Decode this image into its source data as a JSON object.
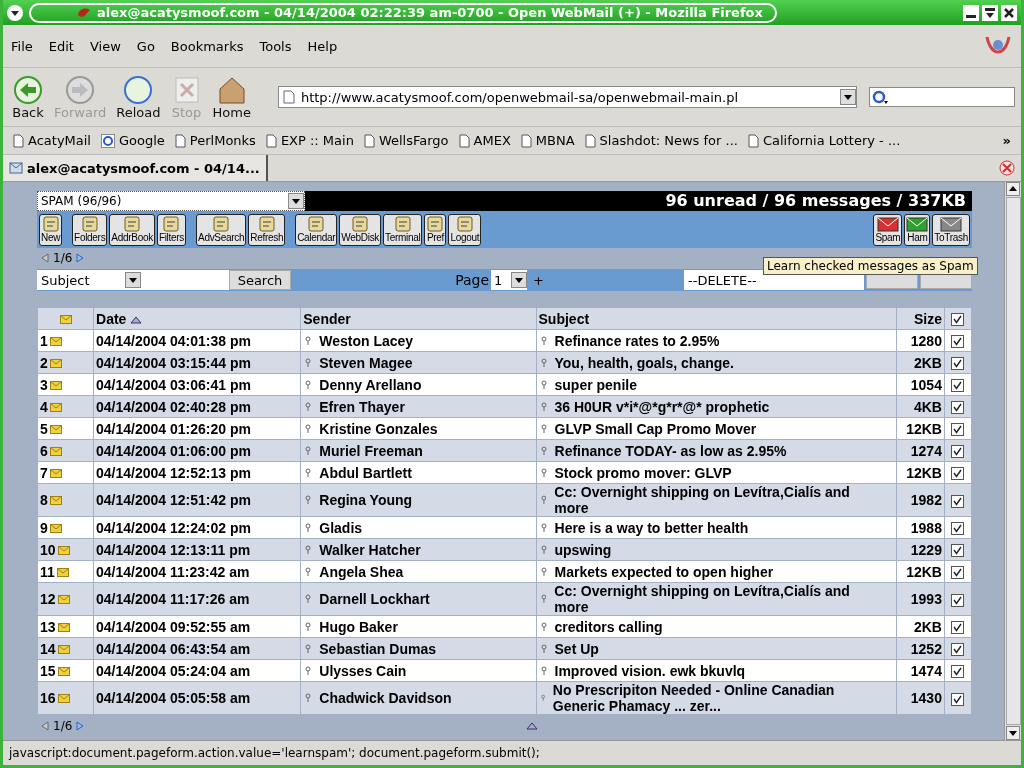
{
  "window": {
    "title": "alex@acatysmoof.com - 04/14/2004 02:22:39 am-0700 - Open WebMail (+) - Mozilla Firefox"
  },
  "menu": [
    "File",
    "Edit",
    "View",
    "Go",
    "Bookmarks",
    "Tools",
    "Help"
  ],
  "nav_buttons": [
    {
      "label": "Back",
      "kind": "back",
      "disabled": false
    },
    {
      "label": "Forward",
      "kind": "forward",
      "disabled": true
    },
    {
      "label": "Reload",
      "kind": "reload",
      "disabled": false
    },
    {
      "label": "Stop",
      "kind": "stop",
      "disabled": true
    },
    {
      "label": "Home",
      "kind": "home",
      "disabled": false
    }
  ],
  "url": "http://www.acatysmoof.com/openwebmail-sa/openwebmail-main.pl",
  "bookmarks": [
    {
      "label": "AcatyMail",
      "kind": "page"
    },
    {
      "label": "Google",
      "kind": "google"
    },
    {
      "label": "PerlMonks",
      "kind": "page"
    },
    {
      "label": "EXP :: Main",
      "kind": "page"
    },
    {
      "label": "WellsFargo",
      "kind": "page"
    },
    {
      "label": "AMEX",
      "kind": "page"
    },
    {
      "label": "MBNA",
      "kind": "page"
    },
    {
      "label": "Slashdot: News for ...",
      "kind": "page"
    },
    {
      "label": "California Lottery - ...",
      "kind": "page"
    }
  ],
  "bookmarks_more": "»",
  "tab": {
    "title": "alex@acatysmoof.com - 04/14..."
  },
  "folder_select": "SPAM (96/96)",
  "summary": "96 unread / 96 messages / 337KB",
  "toolbar_groups": [
    {
      "buttons": [
        "New"
      ]
    },
    {
      "buttons": [
        "Folders",
        "AddrBook",
        "Filters"
      ]
    },
    {
      "buttons": [
        "AdvSearch",
        "Refresh"
      ]
    },
    {
      "buttons": [
        "Calendar",
        "WebDisk",
        "Terminal",
        "Pref",
        "Logout"
      ]
    }
  ],
  "right_buttons": [
    {
      "label": "Spam",
      "kind": "spam"
    },
    {
      "label": "Ham",
      "kind": "ham"
    },
    {
      "label": "ToTrash",
      "kind": "trash"
    }
  ],
  "pager_top": "1/6",
  "search": {
    "field": "Subject",
    "button": "Search"
  },
  "page_label": "Page",
  "page_value": "1",
  "page_plus": "+",
  "action_select": "--DELETE--",
  "tooltip": "Learn checked messages as Spam",
  "columns": {
    "date": "Date",
    "sender": "Sender",
    "subject": "Subject",
    "size": "Size",
    "all_checked": true
  },
  "rows": [
    {
      "num": "1",
      "date": "04/14/2004 04:01:38 pm",
      "sender": "Weston Lacey",
      "subject": "Refinance rates to 2.95%",
      "size": "1280",
      "checked": true
    },
    {
      "num": "2",
      "date": "04/14/2004 03:15:44 pm",
      "sender": "Steven Magee",
      "subject": "You, health, goals, change.",
      "size": "2KB",
      "checked": true
    },
    {
      "num": "3",
      "date": "04/14/2004 03:06:41 pm",
      "sender": "Denny Arellano",
      "subject": "super penile",
      "size": "1054",
      "checked": true
    },
    {
      "num": "4",
      "date": "04/14/2004 02:40:28 pm",
      "sender": "Efren Thayer",
      "subject": "36 H0UR v*i*@*g*r*@* prophetic",
      "size": "4KB",
      "checked": true
    },
    {
      "num": "5",
      "date": "04/14/2004 01:26:20 pm",
      "sender": "Kristine Gonzales",
      "subject": "GLVP Small Cap Promo Mover",
      "size": "12KB",
      "checked": true
    },
    {
      "num": "6",
      "date": "04/14/2004 01:06:00 pm",
      "sender": "Muriel Freeman",
      "subject": "Refinance TODAY- as low as 2.95%",
      "size": "1274",
      "checked": true
    },
    {
      "num": "7",
      "date": "04/14/2004 12:52:13 pm",
      "sender": "Abdul Bartlett",
      "subject": "Stock promo mover: GLVP",
      "size": "12KB",
      "checked": true
    },
    {
      "num": "8",
      "date": "04/14/2004 12:51:42 pm",
      "sender": "Regina Young",
      "subject": "Cc: Overnight shipping on Levítra,Cialís and more",
      "size": "1982",
      "checked": true
    },
    {
      "num": "9",
      "date": "04/14/2004 12:24:02 pm",
      "sender": "Gladis",
      "subject": "Here is a way to better health",
      "size": "1988",
      "checked": true
    },
    {
      "num": "10",
      "date": "04/14/2004 12:13:11 pm",
      "sender": "Walker Hatcher",
      "subject": "upswing",
      "size": "1229",
      "checked": true
    },
    {
      "num": "11",
      "date": "04/14/2004 11:23:42 am",
      "sender": "Angela Shea",
      "subject": "Markets expected to open higher",
      "size": "12KB",
      "checked": true
    },
    {
      "num": "12",
      "date": "04/14/2004 11:17:26 am",
      "sender": "Darnell Lockhart",
      "subject": "Cc: Overnight shipping on Levítra,Cialís and more",
      "size": "1993",
      "checked": true
    },
    {
      "num": "13",
      "date": "04/14/2004 09:52:55 am",
      "sender": "Hugo Baker",
      "subject": "creditors calling",
      "size": "2KB",
      "checked": true
    },
    {
      "num": "14",
      "date": "04/14/2004 06:43:54 am",
      "sender": "Sebastian Dumas",
      "subject": "Set Up",
      "size": "1252",
      "checked": true
    },
    {
      "num": "15",
      "date": "04/14/2004 05:24:04 am",
      "sender": "Ulysses Cain",
      "subject": "Improved vision. ewk bkuvlq",
      "size": "1474",
      "checked": true
    },
    {
      "num": "16",
      "date": "04/14/2004 05:05:58 am",
      "sender": "Chadwick Davidson",
      "subject": "No Prescripiton Needed - Online Canadian Generic Phamacy ... zer...",
      "size": "1430",
      "checked": true
    }
  ],
  "pager_bottom": "1/6",
  "status": "javascript:document.pageform.action.value='learnspam'; document.pageform.submit();"
}
